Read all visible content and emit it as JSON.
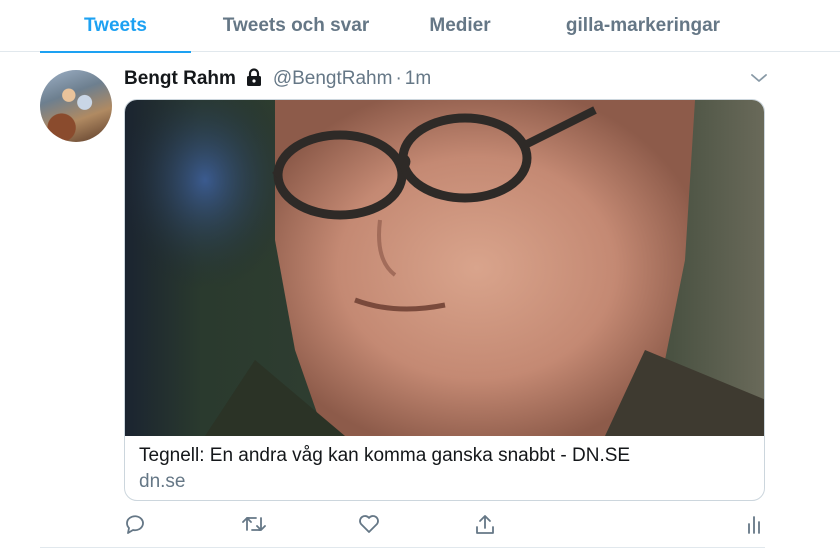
{
  "tabs": [
    {
      "label": "Tweets",
      "active": true
    },
    {
      "label": "Tweets och svar",
      "active": false
    },
    {
      "label": "Medier",
      "active": false
    },
    {
      "label": "gilla-markeringar",
      "active": false
    }
  ],
  "tweet": {
    "author_name": "Bengt Rahm",
    "handle": "@BengtRahm",
    "separator": "·",
    "time": "1m",
    "locked": true,
    "card": {
      "title": "Tegnell: En andra våg kan komma ganska snabbt - DN.SE",
      "domain": "dn.se"
    },
    "actions": [
      "reply-icon",
      "retweet-icon",
      "like-icon",
      "share-icon",
      "analytics-icon"
    ]
  },
  "colors": {
    "accent": "#1da1f2",
    "secondary_text": "#657786",
    "border": "#e1e8ed"
  }
}
